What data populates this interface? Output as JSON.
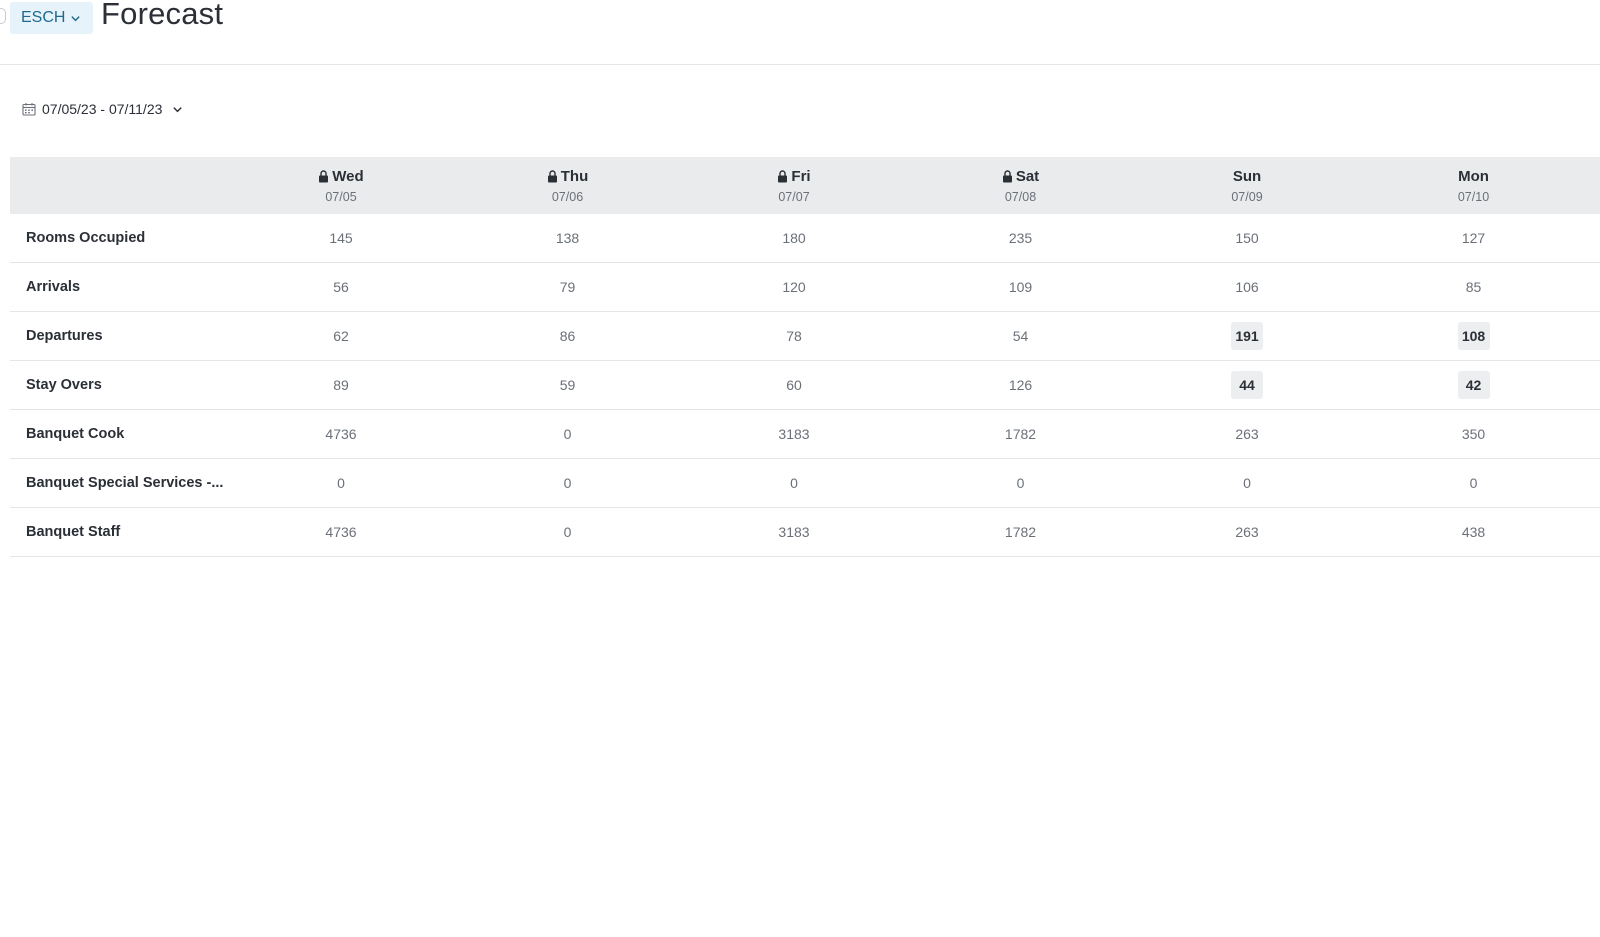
{
  "header": {
    "property": "ESCH",
    "title": "Forecast"
  },
  "date_range": "07/05/23 - 07/11/23",
  "table": {
    "columns": [
      {
        "day": "Wed",
        "date": "07/05",
        "locked": true
      },
      {
        "day": "Thu",
        "date": "07/06",
        "locked": true
      },
      {
        "day": "Fri",
        "date": "07/07",
        "locked": true
      },
      {
        "day": "Sat",
        "date": "07/08",
        "locked": true
      },
      {
        "day": "Sun",
        "date": "07/09",
        "locked": false
      },
      {
        "day": "Mon",
        "date": "07/10",
        "locked": false
      }
    ],
    "rows": [
      {
        "label": "Rooms Occupied",
        "values": [
          "145",
          "138",
          "180",
          "235",
          "150",
          "127"
        ],
        "highlight": [
          false,
          false,
          false,
          false,
          false,
          false
        ]
      },
      {
        "label": "Arrivals",
        "values": [
          "56",
          "79",
          "120",
          "109",
          "106",
          "85"
        ],
        "highlight": [
          false,
          false,
          false,
          false,
          false,
          false
        ]
      },
      {
        "label": "Departures",
        "values": [
          "62",
          "86",
          "78",
          "54",
          "191",
          "108"
        ],
        "highlight": [
          false,
          false,
          false,
          false,
          true,
          true
        ]
      },
      {
        "label": "Stay Overs",
        "values": [
          "89",
          "59",
          "60",
          "126",
          "44",
          "42"
        ],
        "highlight": [
          false,
          false,
          false,
          false,
          true,
          true
        ]
      },
      {
        "label": "Banquet Cook",
        "values": [
          "4736",
          "0",
          "3183",
          "1782",
          "263",
          "350"
        ],
        "highlight": [
          false,
          false,
          false,
          false,
          false,
          false
        ]
      },
      {
        "label": "Banquet Special Services -...",
        "values": [
          "0",
          "0",
          "0",
          "0",
          "0",
          "0"
        ],
        "highlight": [
          false,
          false,
          false,
          false,
          false,
          false
        ]
      },
      {
        "label": "Banquet Staff",
        "values": [
          "4736",
          "0",
          "3183",
          "1782",
          "263",
          "438"
        ],
        "highlight": [
          false,
          false,
          false,
          false,
          false,
          false
        ]
      }
    ]
  },
  "icons": {
    "property_dropdown": "chevron-down-icon",
    "date_picker": "calendar-icon",
    "date_dropdown": "chevron-down-icon",
    "locked_day": "lock-icon"
  },
  "colors": {
    "property_bg": "#e6f3fa",
    "property_text": "#1f6a8e",
    "table_header_bg": "#eaebed",
    "highlight_bg": "#eceef0"
  }
}
